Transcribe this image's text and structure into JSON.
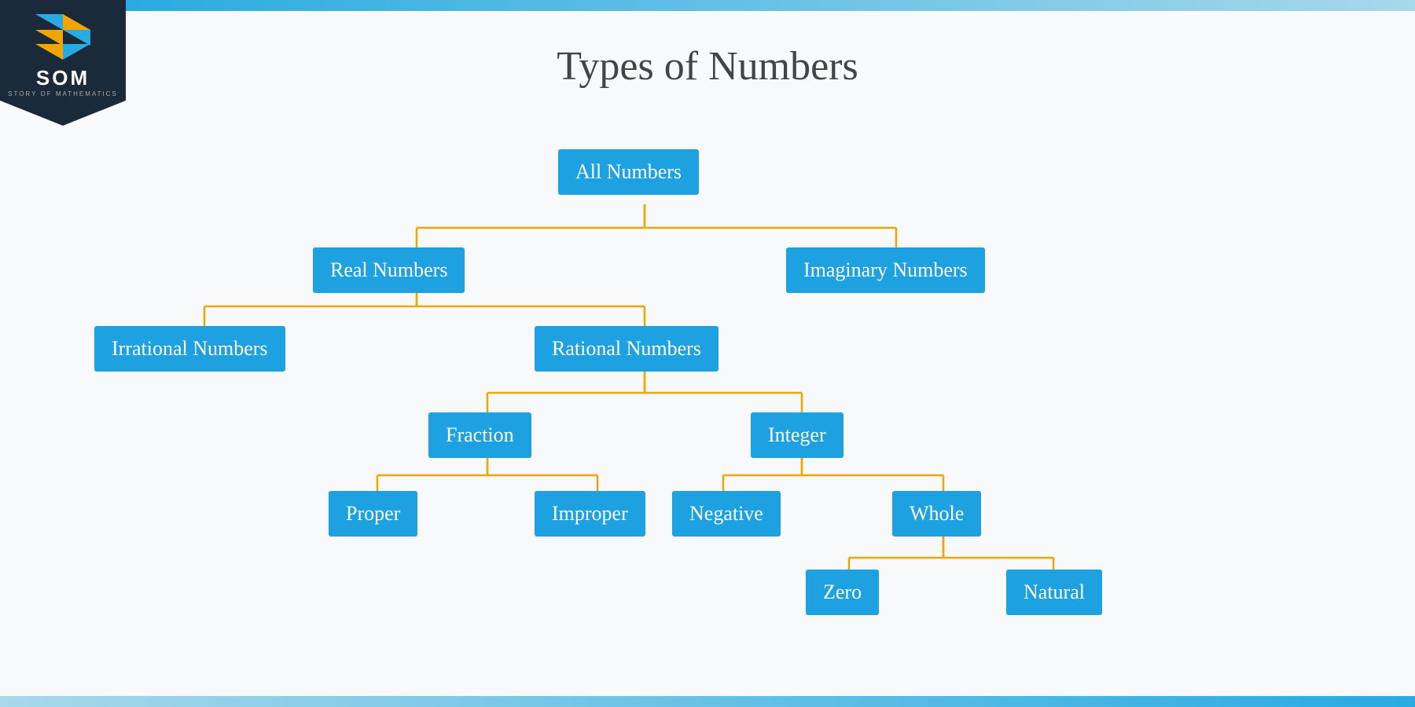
{
  "page": {
    "title": "Types of Numbers"
  },
  "logo": {
    "text": "SOM",
    "subtext": "STORY OF MATHEMATICS"
  },
  "nodes": {
    "all_numbers": {
      "label": "All Numbers"
    },
    "real_numbers": {
      "label": "Real Numbers"
    },
    "imaginary_numbers": {
      "label": "Imaginary Numbers"
    },
    "irrational_numbers": {
      "label": "Irrational Numbers"
    },
    "rational_numbers": {
      "label": "Rational Numbers"
    },
    "fraction": {
      "label": "Fraction"
    },
    "integer": {
      "label": "Integer"
    },
    "proper": {
      "label": "Proper"
    },
    "improper": {
      "label": "Improper"
    },
    "negative": {
      "label": "Negative"
    },
    "whole": {
      "label": "Whole"
    },
    "zero": {
      "label": "Zero"
    },
    "natural": {
      "label": "Natural"
    }
  },
  "colors": {
    "node_bg": "#1da1e0",
    "node_text": "#ffffff",
    "line_color": "#f0a500",
    "line_width": 2
  }
}
